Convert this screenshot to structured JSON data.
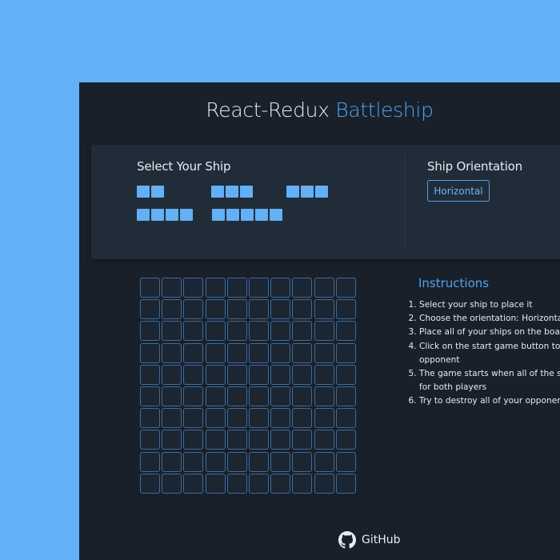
{
  "header": {
    "title_plain": "React-Redux",
    "title_accent": "Battleship"
  },
  "ship_panel": {
    "heading": "Select Your Ship",
    "ships": [
      {
        "name": "ship-2",
        "length": 2
      },
      {
        "name": "ship-3a",
        "length": 3
      },
      {
        "name": "ship-3b",
        "length": 3
      },
      {
        "name": "ship-4",
        "length": 4
      },
      {
        "name": "ship-5",
        "length": 5
      }
    ]
  },
  "orientation_panel": {
    "heading": "Ship Orientation",
    "button_label": "Horizontal"
  },
  "board": {
    "rows": 10,
    "cols": 10
  },
  "instructions": {
    "title": "Instructions",
    "items": [
      "Select your ship to place it",
      "Choose the orientation: Horizontal or",
      "Place all of your ships on the board",
      "Click on the start game button to get your opponent",
      "The game starts when all of the ships board for both players",
      "Try to destroy all of your opponents s yours!"
    ]
  },
  "footer": {
    "github_label": "GitHub",
    "icon": "github-icon"
  },
  "colors": {
    "page_bg": "#64b0f6",
    "app_bg": "#19202a",
    "panel_bg": "#212c39",
    "accent": "#4ea4ee",
    "ship_fill": "#64b0f6",
    "cell_border": "#3a6e9f"
  }
}
